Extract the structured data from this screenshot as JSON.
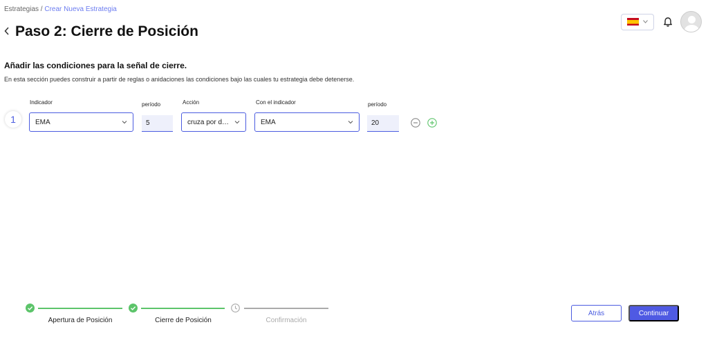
{
  "breadcrumb": {
    "root": "Estrategias",
    "separator": " / ",
    "current": "Crear Nueva Estrategia"
  },
  "header": {
    "back_icon": "chevron-left-icon",
    "title": "Paso 2: Cierre de Posición",
    "language_flag": "spain-flag-icon",
    "notifications_icon": "bell-icon",
    "avatar_icon": "user-avatar-icon"
  },
  "section": {
    "title": "Añadir las condiciones para la señal de cierre.",
    "description": "En esta sección puedes construir a partir de reglas o anidaciones las condiciones bajo las cuales tu estrategia debe detenerse."
  },
  "rule": {
    "number": "1",
    "indicator": {
      "label": "Indicador",
      "value": "EMA"
    },
    "period1": {
      "label": "período",
      "value": "5"
    },
    "action": {
      "label": "Acción",
      "value": "cruza por debajo"
    },
    "target_indicator": {
      "label": "Con el indicador",
      "value": "EMA"
    },
    "period2": {
      "label": "período",
      "value": "20"
    },
    "remove_icon": "minus-circle-icon",
    "add_icon": "plus-circle-icon"
  },
  "progress": {
    "steps": [
      {
        "label": "Apertura de Posición",
        "status": "complete"
      },
      {
        "label": "Cierre de Posición",
        "status": "complete"
      },
      {
        "label": "Confirmación",
        "status": "pending"
      }
    ]
  },
  "footer": {
    "back_label": "Atrás",
    "continue_label": "Continuar"
  },
  "colors": {
    "primary": "#4f5ae3",
    "success": "#5cc46a",
    "muted": "#aaaaaa"
  }
}
